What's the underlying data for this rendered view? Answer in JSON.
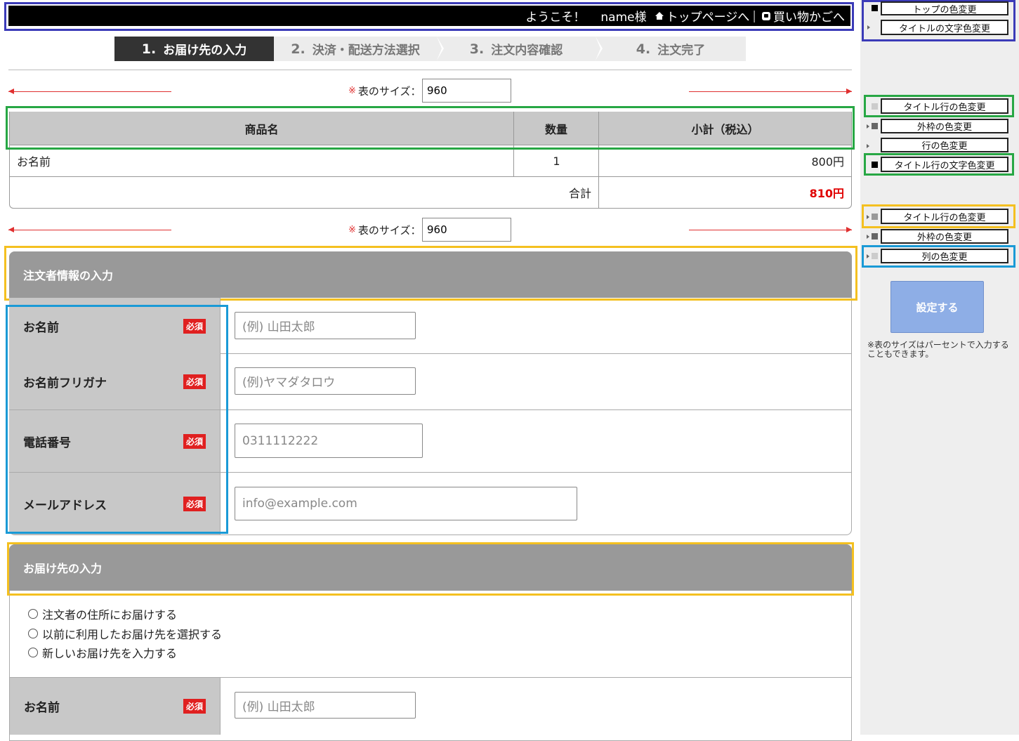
{
  "header": {
    "welcome": "ようこそ！",
    "user": "name様",
    "top_link": "トップページへ",
    "separator": "|",
    "cart_link": "買い物かごへ"
  },
  "steps": [
    {
      "num": "1.",
      "label": "お届け先の入力",
      "active": true
    },
    {
      "num": "2.",
      "label": "決済・配送方法選択",
      "active": false
    },
    {
      "num": "3.",
      "label": "注文内容確認",
      "active": false
    },
    {
      "num": "4.",
      "label": "注文完了",
      "active": false
    }
  ],
  "table_size": {
    "mark": "※",
    "label": "表のサイズ：",
    "value": "960"
  },
  "cart": {
    "headers": [
      "商品名",
      "数量",
      "小計（税込）"
    ],
    "row": {
      "name": "お名前",
      "qty": "1",
      "subtotal": "800円"
    },
    "total_label": "合計",
    "total_value": "810円"
  },
  "orderer": {
    "title": "注文者情報の入力",
    "required": "必須",
    "fields": [
      {
        "label": "お名前",
        "placeholder": "(例) 山田太郎"
      },
      {
        "label": "お名前フリガナ",
        "placeholder": "(例)ヤマダタロウ"
      },
      {
        "label": "電話番号",
        "placeholder": "0311112222"
      },
      {
        "label": "メールアドレス",
        "placeholder": "info@example.com"
      }
    ]
  },
  "delivery": {
    "title": "お届け先の入力",
    "options": [
      "注文者の住所にお届けする",
      "以前に利用したお届け先を選択する",
      "新しいお届け先を入力する"
    ],
    "field": {
      "label": "お名前",
      "placeholder": "(例) 山田太郎"
    }
  },
  "panel": {
    "top_color": "トップの色変更",
    "title_text_color": "タイトルの文字色変更",
    "title_row_color": "タイトル行の色変更",
    "border_color": "外枠の色変更",
    "row_color": "行の色変更",
    "title_row_text_color": "タイトル行の文字色変更",
    "title_row_color2": "タイトル行の色変更",
    "border_color2": "外枠の色変更",
    "column_color": "列の色変更",
    "apply": "設定する",
    "note": "※表のサイズはパーセントで入力することもできます。"
  },
  "colors": {
    "accent_blue": "#3b3bb8",
    "green": "#27a744",
    "yellow": "#f4c020",
    "cyan": "#1a9ad6",
    "required_red": "#e02020"
  }
}
